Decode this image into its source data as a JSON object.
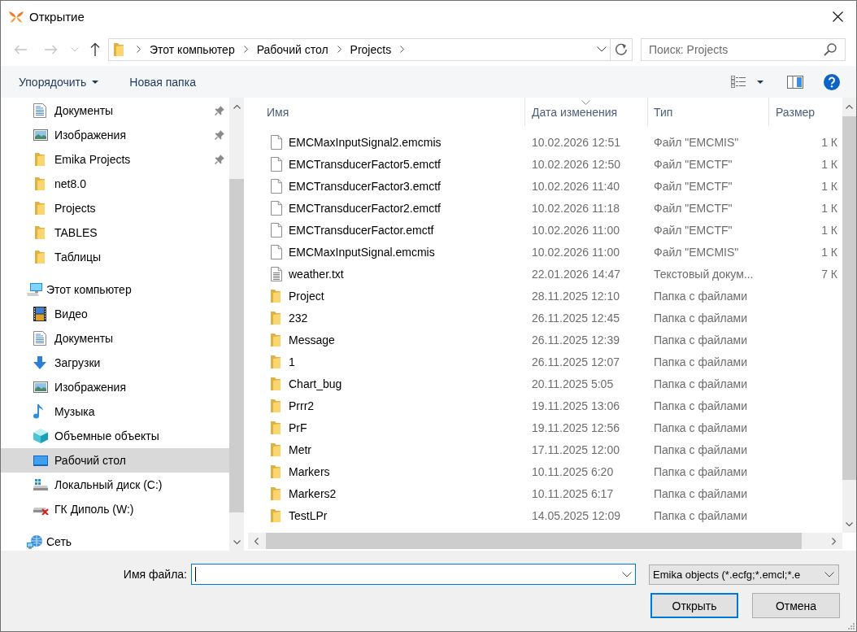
{
  "window": {
    "title": "Открытие"
  },
  "navigation_buttons": [
    {
      "kind": "back",
      "disabled": true
    },
    {
      "kind": "forward",
      "disabled": true
    },
    {
      "kind": "recent",
      "disabled": true
    },
    {
      "kind": "up",
      "disabled": false
    }
  ],
  "address_bar": {
    "breadcrumbs": [
      "Этот компьютер",
      "Рабочий стол",
      "Projects"
    ]
  },
  "search": {
    "placeholder": "Поиск: Projects"
  },
  "command_bar": {
    "commands": [
      {
        "label": "Упорядочить",
        "has_menu": true
      },
      {
        "label": "Новая папка",
        "has_menu": false
      }
    ]
  },
  "navigation_pane": {
    "quick_access": [
      {
        "label": "Документы",
        "kind": "documents",
        "pinned": true,
        "selected": false
      },
      {
        "label": "Изображения",
        "kind": "pictures",
        "pinned": true,
        "selected": false
      },
      {
        "label": "Emika Projects",
        "kind": "folder",
        "pinned": true,
        "selected": false
      },
      {
        "label": "net8.0",
        "kind": "folder",
        "pinned": false,
        "selected": false
      },
      {
        "label": "Projects",
        "kind": "folder",
        "pinned": false,
        "selected": false
      },
      {
        "label": "TABLES",
        "kind": "folder",
        "pinned": false,
        "selected": false
      },
      {
        "label": "Таблицы",
        "kind": "folder",
        "pinned": false,
        "selected": false
      }
    ],
    "tree": [
      {
        "label": "Этот компьютер",
        "kind": "computer",
        "selected": false,
        "children": [
          {
            "label": "Видео",
            "kind": "video",
            "selected": false
          },
          {
            "label": "Документы",
            "kind": "documents",
            "selected": false
          },
          {
            "label": "Загрузки",
            "kind": "downloads",
            "selected": false
          },
          {
            "label": "Изображения",
            "kind": "pictures",
            "selected": false
          },
          {
            "label": "Музыка",
            "kind": "music",
            "selected": false
          },
          {
            "label": "Объемные объекты",
            "kind": "objects3d",
            "selected": false
          },
          {
            "label": "Рабочий стол",
            "kind": "desktop",
            "selected": true
          },
          {
            "label": "Локальный диск (C:)",
            "kind": "drive",
            "selected": false
          },
          {
            "label": "ГК Диполь (W:)",
            "kind": "network_drive_disconnected",
            "selected": false
          }
        ]
      },
      {
        "label": "Сеть",
        "kind": "network",
        "selected": false
      }
    ]
  },
  "file_list": {
    "columns": [
      {
        "label": "Имя",
        "sorted": false
      },
      {
        "label": "Дата изменения",
        "sorted": true
      },
      {
        "label": "Тип",
        "sorted": false
      },
      {
        "label": "Размер",
        "sorted": false
      }
    ],
    "rows": [
      {
        "kind": "file",
        "name": "EMCMaxInputSignal2.emcmis",
        "date": "10.02.2026 12:51",
        "type": "Файл \"EMCMIS\"",
        "size": "1 К",
        "selected": false
      },
      {
        "kind": "file",
        "name": "EMCTransducerFactor5.emctf",
        "date": "10.02.2026 12:50",
        "type": "Файл \"EMCTF\"",
        "size": "1 К",
        "selected": false
      },
      {
        "kind": "file",
        "name": "EMCTransducerFactor3.emctf",
        "date": "10.02.2026 11:40",
        "type": "Файл \"EMCTF\"",
        "size": "1 К",
        "selected": false
      },
      {
        "kind": "file",
        "name": "EMCTransducerFactor2.emctf",
        "date": "10.02.2026 11:18",
        "type": "Файл \"EMCTF\"",
        "size": "1 К",
        "selected": false
      },
      {
        "kind": "file",
        "name": "EMCTransducerFactor.emctf",
        "date": "10.02.2026 11:00",
        "type": "Файл \"EMCTF\"",
        "size": "1 К",
        "selected": false
      },
      {
        "kind": "file",
        "name": "EMCMaxInputSignal.emcmis",
        "date": "10.02.2026 11:00",
        "type": "Файл \"EMCMIS\"",
        "size": "1 К",
        "selected": false
      },
      {
        "kind": "text",
        "name": "weather.txt",
        "date": "22.01.2026 14:47",
        "type": "Текстовый докум...",
        "size": "7 К",
        "selected": false
      },
      {
        "kind": "folder",
        "name": "Project",
        "date": "28.11.2025 12:10",
        "type": "Папка с файлами",
        "selected": false
      },
      {
        "kind": "folder",
        "name": "232",
        "date": "26.11.2025 12:45",
        "type": "Папка с файлами",
        "selected": false
      },
      {
        "kind": "folder",
        "name": "Message",
        "date": "26.11.2025 12:39",
        "type": "Папка с файлами",
        "selected": false
      },
      {
        "kind": "folder",
        "name": "1",
        "date": "26.11.2025 12:07",
        "type": "Папка с файлами",
        "selected": false
      },
      {
        "kind": "folder",
        "name": "Chart_bug",
        "date": "20.11.2025 5:05",
        "type": "Папка с файлами",
        "selected": false
      },
      {
        "kind": "folder",
        "name": "Prrr2",
        "date": "19.11.2025 13:06",
        "type": "Папка с файлами",
        "selected": false
      },
      {
        "kind": "folder",
        "name": "PrF",
        "date": "19.11.2025 12:56",
        "type": "Папка с файлами",
        "selected": false
      },
      {
        "kind": "folder",
        "name": "Metr",
        "date": "17.11.2025 12:00",
        "type": "Папка с файлами",
        "selected": false
      },
      {
        "kind": "folder",
        "name": "Markers",
        "date": "10.11.2025 6:20",
        "type": "Папка с файлами",
        "selected": false
      },
      {
        "kind": "folder",
        "name": "Markers2",
        "date": "10.11.2025 6:17",
        "type": "Папка с файлами",
        "selected": false
      },
      {
        "kind": "folder",
        "name": "TestLPr",
        "date": "14.05.2025 12:09",
        "type": "Папка с файлами",
        "selected": false
      }
    ]
  },
  "file_name": {
    "label": "Имя файла:",
    "focused": true
  },
  "file_type_filter": {
    "value": "Emika objects (*.ecfg;*.emcl;*.e"
  },
  "buttons": [
    {
      "label": "Открыть",
      "default": true
    },
    {
      "label": "Отмена",
      "default": false
    }
  ]
}
